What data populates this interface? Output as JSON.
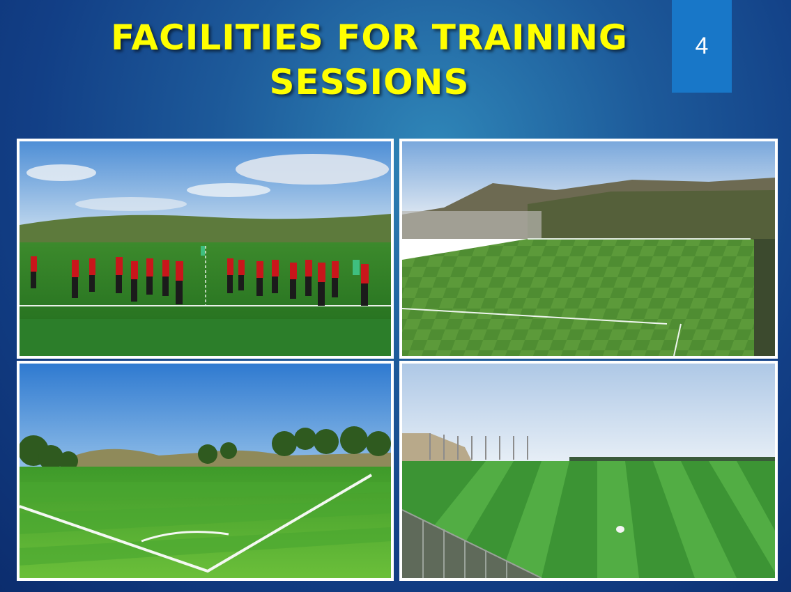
{
  "slide": {
    "title_line1": "FACILITIES FOR TRAINING",
    "title_line2": "SESSIONS",
    "page_number": "4"
  },
  "colors": {
    "title": "#ffff00",
    "page_box": "#1877c8",
    "background": "#123f86"
  }
}
